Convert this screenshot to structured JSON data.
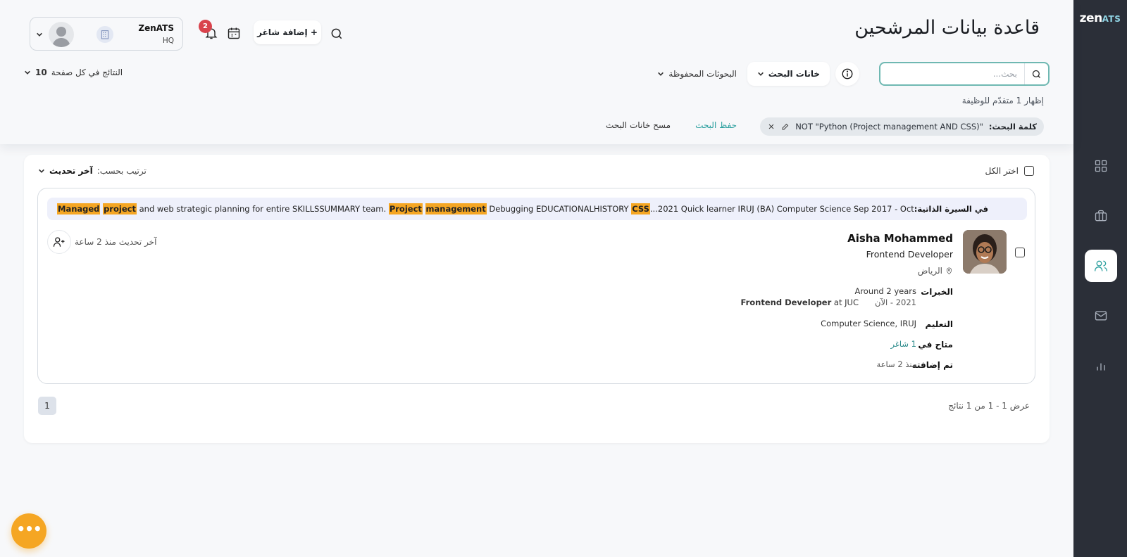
{
  "brand": {
    "logo_main": "zen",
    "logo_accent": "ATS"
  },
  "page": {
    "title": "قاعدة بيانات المرشحين"
  },
  "search": {
    "placeholder": "بحث...",
    "fields_label": "خانات البحث",
    "saved_label": "البحوثات المحفوظة"
  },
  "per_page": {
    "label": "النتائج في كل صفحة",
    "value": "10"
  },
  "showing": "إظهار 1 متقدّم للوظيفة",
  "keyword_chip": {
    "label": "كلمة البحث:",
    "value": "NOT \"Python (Project management AND CSS)\""
  },
  "actions": {
    "save_search": "حفظ البحث",
    "clear_fields": "مسح خانات البحث"
  },
  "topbar": {
    "add_job": "+ إضافة شاغر",
    "notifications_count": "2"
  },
  "org": {
    "name": "ZenATS",
    "sub": "HQ"
  },
  "results": {
    "select_all": "اختر الكل",
    "sort_label": "ترتيب بحسب:",
    "sort_value": "آخر تحديث",
    "range_text": "عرض 1 - 1 من 1 نتائج",
    "current_page": "1"
  },
  "candidate": {
    "snippet_label": "في السيرة الذاتية:",
    "snippet_parts": [
      {
        "text": "...2021 Quick learner IRUJ (BA) Computer Science Sep 2017 - Oct ",
        "hl": false
      },
      {
        "text": "CSS",
        "hl": true
      },
      {
        "text": " Debugging EDUCATIONALHISTORY ",
        "hl": false
      },
      {
        "text": "management",
        "hl": true
      },
      {
        "text": " ",
        "hl": false
      },
      {
        "text": "Project",
        "hl": true
      },
      {
        "text": " and web strategic planning for entire SKILLSSUMMARY team. ",
        "hl": false
      },
      {
        "text": "project",
        "hl": true
      },
      {
        "text": " ",
        "hl": false
      },
      {
        "text": "Managed",
        "hl": true
      }
    ],
    "name": "Aisha Mohammed",
    "title": "Frontend Developer",
    "location": "الرياض",
    "updated": "آخر تحديث منذ 2 ساعة",
    "experience_label": "الخبرات",
    "experience_duration": "Around 2 years",
    "experience_period": "2021 - الآن",
    "experience_role": "Frontend Developer",
    "experience_at": " at JUC",
    "education_label": "التعليم",
    "education_value": "Computer Science, IRUJ",
    "available_label": "متاح في",
    "available_value": "1 شاغر",
    "added_label": "تم إضافته",
    "added_value": "منذ 2 ساعة"
  }
}
